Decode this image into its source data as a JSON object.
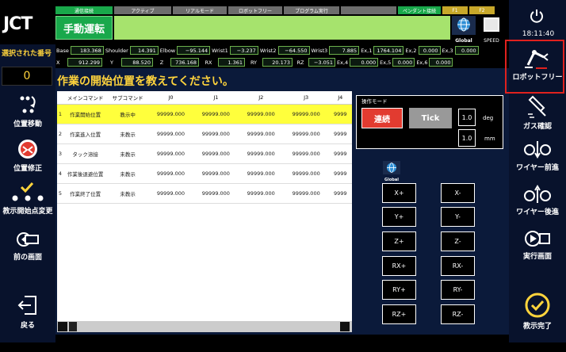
{
  "logo": "JCT",
  "status_bar": [
    {
      "label": "通信接続",
      "color": "#19a84b"
    },
    {
      "label": "アクティブ",
      "color": "#6d6d6d"
    },
    {
      "label": "リアルモード",
      "color": "#6d6d6d"
    },
    {
      "label": "ロボットフリー",
      "color": "#6d6d6d"
    },
    {
      "label": "プログラム実行",
      "color": "#6d6d6d"
    },
    {
      "label": "",
      "color": "#6d6d6d"
    },
    {
      "label": "ペンダント接続",
      "color": "#19a84b"
    },
    {
      "label": "F1",
      "color": "#c8a82a"
    },
    {
      "label": "F2",
      "color": "#c8a82a"
    }
  ],
  "mode": "手動運転",
  "global_label": "Global",
  "speed_label": "SPEED",
  "time": "18:11:40",
  "joints_row": [
    {
      "label": "Base",
      "value": "183.368"
    },
    {
      "label": "Shoulder",
      "value": "14.391"
    },
    {
      "label": "Elbow",
      "value": "−95.144"
    },
    {
      "label": "Wrist1",
      "value": "−3.237"
    },
    {
      "label": "Wrist2",
      "value": "−64.550"
    },
    {
      "label": "Wrist3",
      "value": "7.885"
    },
    {
      "label": "Ex,1",
      "value": "1764.104"
    },
    {
      "label": "Ex,2",
      "value": "0.000"
    },
    {
      "label": "Ex,3",
      "value": "0.000"
    }
  ],
  "coords_row": [
    {
      "label": "X",
      "value": "912.299"
    },
    {
      "label": "Y",
      "value": "88.520"
    },
    {
      "label": "Z",
      "value": "736.168"
    },
    {
      "label": "RX",
      "value": "1.361"
    },
    {
      "label": "RY",
      "value": "20.173"
    },
    {
      "label": "RZ",
      "value": "−3.051"
    },
    {
      "label": "Ex,4",
      "value": "0.000"
    },
    {
      "label": "Ex,5",
      "value": "0.000"
    },
    {
      "label": "Ex,6",
      "value": "0.000"
    }
  ],
  "selected_label": "選択された番号",
  "selected_number": "0",
  "prompt": "作業の開始位置を教えてください。",
  "left_buttons": [
    {
      "label": "位置移動"
    },
    {
      "label": "位置修正"
    },
    {
      "label": "教示開始点変更"
    },
    {
      "label": "前の画面"
    },
    {
      "label": "戻る"
    }
  ],
  "right_buttons": [
    {
      "label": "ロボットフリー"
    },
    {
      "label": "ガス確認"
    },
    {
      "label": "ワイヤー前進"
    },
    {
      "label": "ワイヤー後進"
    },
    {
      "label": "実行画面"
    },
    {
      "label": "教示完了"
    }
  ],
  "table": {
    "headers": [
      "メインコマンド",
      "サブコマンド",
      "J0",
      "J1",
      "J2",
      "J3",
      "J4"
    ],
    "rows": [
      {
        "no": "1",
        "main": "作業開始位置",
        "sub": "教示中",
        "j0": "99999.000",
        "j1": "99999.000",
        "j2": "99999.000",
        "j3": "99999.000",
        "j4": "9999"
      },
      {
        "no": "2",
        "main": "作業進入位置",
        "sub": "未教示",
        "j0": "99999.000",
        "j1": "99999.000",
        "j2": "99999.000",
        "j3": "99999.000",
        "j4": "9999"
      },
      {
        "no": "3",
        "main": "タック溶接",
        "sub": "未教示",
        "j0": "99999.000",
        "j1": "99999.000",
        "j2": "99999.000",
        "j3": "99999.000",
        "j4": "9999"
      },
      {
        "no": "4",
        "main": "作業後退避位置",
        "sub": "未教示",
        "j0": "99999.000",
        "j1": "99999.000",
        "j2": "99999.000",
        "j3": "99999.000",
        "j4": "9999"
      },
      {
        "no": "5",
        "main": "作業終了位置",
        "sub": "未教示",
        "j0": "99999.000",
        "j1": "99999.000",
        "j2": "99999.000",
        "j3": "99999.000",
        "j4": "9999"
      }
    ]
  },
  "op_mode": {
    "title": "操作モード",
    "continuous": "連続",
    "tick": "Tick",
    "deg_value": "1.0",
    "deg_unit": "deg",
    "mm_value": "1.0",
    "mm_unit": "mm"
  },
  "jog": {
    "left": [
      "X+",
      "Y+",
      "Z+",
      "RX+",
      "RY+",
      "RZ+"
    ],
    "right": [
      "X-",
      "Y-",
      "Z-",
      "RX-",
      "RY-",
      "RZ-"
    ]
  }
}
